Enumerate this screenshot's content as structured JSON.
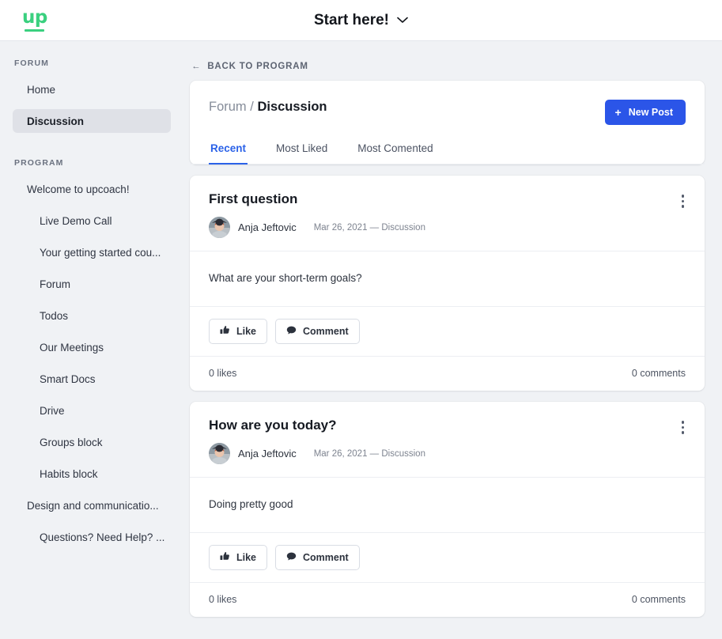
{
  "topbar": {
    "logo_text": "up",
    "logo_name": "upcoach-logo",
    "program_title": "Start here!",
    "chevron": "⌄"
  },
  "sidebar": {
    "forum_label": "FORUM",
    "program_label": "PROGRAM",
    "forum_items": [
      {
        "label": "Home",
        "active": false
      },
      {
        "label": "Discussion",
        "active": true
      }
    ],
    "program_items": [
      {
        "label": "Welcome to upcoach!",
        "indent": false
      },
      {
        "label": "Live Demo Call",
        "indent": true
      },
      {
        "label": "Your getting started cou...",
        "indent": true
      },
      {
        "label": "Forum",
        "indent": true
      },
      {
        "label": "Todos",
        "indent": true
      },
      {
        "label": "Our Meetings",
        "indent": true
      },
      {
        "label": "Smart Docs",
        "indent": true
      },
      {
        "label": "Drive",
        "indent": true
      },
      {
        "label": "Groups block",
        "indent": true
      },
      {
        "label": "Habits block",
        "indent": true
      },
      {
        "label": "Design and communicatio...",
        "indent": false
      },
      {
        "label": "Questions? Need Help? ...",
        "indent": true
      }
    ]
  },
  "main": {
    "back_link": "BACK TO PROGRAM",
    "back_arrow": "←",
    "breadcrumb_parent": "Forum",
    "breadcrumb_sep": "/",
    "breadcrumb_current": "Discussion",
    "new_post_label": "New Post",
    "new_post_plus": "+",
    "tabs": [
      {
        "label": "Recent",
        "active": true
      },
      {
        "label": "Most Liked",
        "active": false
      },
      {
        "label": "Most Comented",
        "active": false
      }
    ],
    "like_label": "Like",
    "comment_label": "Comment",
    "posts": [
      {
        "title": "First question",
        "author": "Anja Jeftovic",
        "date": "Mar 26, 2021 — Discussion",
        "body": "What are your short-term goals?",
        "likes": "0 likes",
        "comments": "0 comments"
      },
      {
        "title": "How are you today?",
        "author": "Anja Jeftovic",
        "date": "Mar 26, 2021 — Discussion",
        "body": "Doing pretty good",
        "likes": "0 likes",
        "comments": "0 comments"
      }
    ]
  },
  "colors": {
    "brand_green": "#3ad07f",
    "accent_blue": "#2b55e8",
    "tab_active_blue": "#2b62e8",
    "page_bg": "#f0f2f5",
    "card_bg": "#ffffff"
  }
}
